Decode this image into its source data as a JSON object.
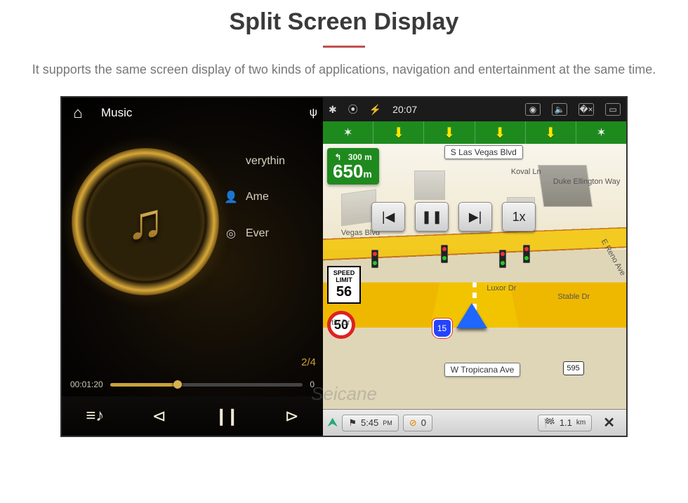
{
  "page": {
    "title": "Split Screen Display",
    "description": "It supports the same screen display of two kinds of applications, navigation and entertainment at the same time."
  },
  "status_bar": {
    "time": "20:07",
    "icons": [
      "bluetooth",
      "location",
      "wifi"
    ],
    "right_icons": [
      "camera",
      "volume",
      "close-window",
      "split-screen"
    ]
  },
  "music": {
    "header_label": "Music",
    "usb_glyph": "ψ",
    "track_title": "verythin",
    "artist": "Ame",
    "album": "Ever",
    "track_index": "2/4",
    "elapsed": "00:01:20",
    "total": "0",
    "progress_pct": 33,
    "controls": {
      "playlist": "≡♪",
      "prev": "◁",
      "pause": "❙❙",
      "next": "▷"
    }
  },
  "nav": {
    "guidance": {
      "primary_dist": "650",
      "primary_unit": "m",
      "secondary_dist": "300",
      "secondary_unit": "m"
    },
    "playback_buttons": {
      "prev": "|◀",
      "pause": "❚❚",
      "next": "▶|",
      "speed": "1x"
    },
    "streets": {
      "top": "S Las Vegas Blvd",
      "koval": "Koval Ln",
      "duke": "Duke Ellington Way",
      "vegas_blvd": "Vegas Blvd",
      "luxor": "Luxor Dr",
      "stable": "Stable Dr",
      "reno": "E Reno Ave",
      "martin": "rtin Dr",
      "tropicana": "W Tropicana Ave"
    },
    "shields": {
      "interstate": "15",
      "route": "595"
    },
    "speed": {
      "limit_label": "SPEED LIMIT",
      "limit": "56",
      "current": "50"
    },
    "bottom": {
      "eta": "5:45",
      "eta_sup": "PM",
      "extra": "0",
      "dist": "1.1",
      "dist_unit": "km"
    }
  },
  "watermark": "Seicane"
}
